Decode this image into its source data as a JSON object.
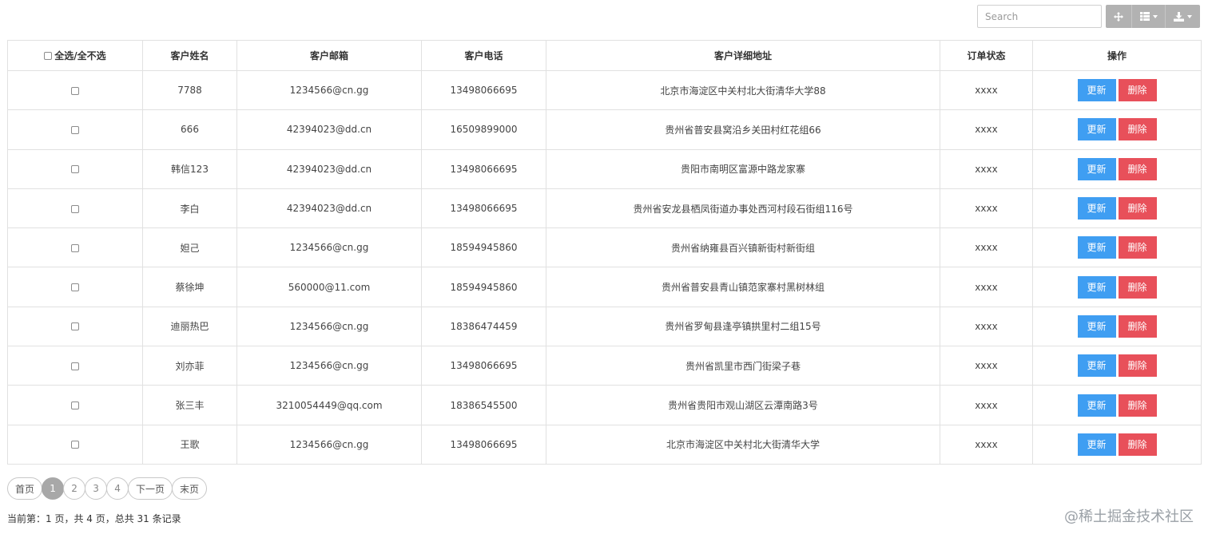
{
  "toolbar": {
    "search_placeholder": "Search",
    "icons": {
      "move": "move-arrows-icon",
      "columns": "columns-grid-icon",
      "export": "download-icon"
    }
  },
  "table": {
    "headers": {
      "select_all": "全选/全不选",
      "name": "客户姓名",
      "email": "客户邮箱",
      "phone": "客户电话",
      "address": "客户详细地址",
      "status": "订单状态",
      "actions": "操作"
    },
    "rows": [
      {
        "name": "7788",
        "email": "1234566@cn.gg",
        "phone": "13498066695",
        "address": "北京市海淀区中关村北大街清华大学88",
        "status": "xxxx"
      },
      {
        "name": "666",
        "email": "42394023@dd.cn",
        "phone": "16509899000",
        "address": "贵州省普安县窝沿乡关田村红花组66",
        "status": "xxxx"
      },
      {
        "name": "韩信123",
        "email": "42394023@dd.cn",
        "phone": "13498066695",
        "address": "贵阳市南明区富源中路龙家寨",
        "status": "xxxx"
      },
      {
        "name": "李白",
        "email": "42394023@dd.cn",
        "phone": "13498066695",
        "address": "贵州省安龙县栖凤街道办事处西河村段石街组116号",
        "status": "xxxx"
      },
      {
        "name": "妲己",
        "email": "1234566@cn.gg",
        "phone": "18594945860",
        "address": "贵州省纳雍县百兴镇新街村新街组",
        "status": "xxxx"
      },
      {
        "name": "蔡徐坤",
        "email": "560000@11.com",
        "phone": "18594945860",
        "address": "贵州省普安县青山镇范家寨村黑树林组",
        "status": "xxxx"
      },
      {
        "name": "迪丽热巴",
        "email": "1234566@cn.gg",
        "phone": "18386474459",
        "address": "贵州省罗甸县逢亭镇拱里村二组15号",
        "status": "xxxx"
      },
      {
        "name": "刘亦菲",
        "email": "1234566@cn.gg",
        "phone": "13498066695",
        "address": "贵州省凯里市西门街梁子巷",
        "status": "xxxx"
      },
      {
        "name": "张三丰",
        "email": "3210054449@qq.com",
        "phone": "18386545500",
        "address": "贵州省贵阳市观山湖区云潭南路3号",
        "status": "xxxx"
      },
      {
        "name": "王歌",
        "email": "1234566@cn.gg",
        "phone": "13498066695",
        "address": "北京市海淀区中关村北大街清华大学",
        "status": "xxxx"
      }
    ],
    "update_label": "更新",
    "delete_label": "删除"
  },
  "pagination": {
    "first": "首页",
    "pages": [
      "1",
      "2",
      "3",
      "4"
    ],
    "current": "1",
    "next": "下一页",
    "last": "末页",
    "summary": "当前第：1 页，共 4 页，总共 31 条记录"
  },
  "watermark": "@稀土掘金技术社区",
  "colors": {
    "update_button": "#3f9ef2",
    "delete_button": "#e8505a",
    "toolbar_button": "#b2b2b2",
    "active_page": "#a8a8a8"
  }
}
